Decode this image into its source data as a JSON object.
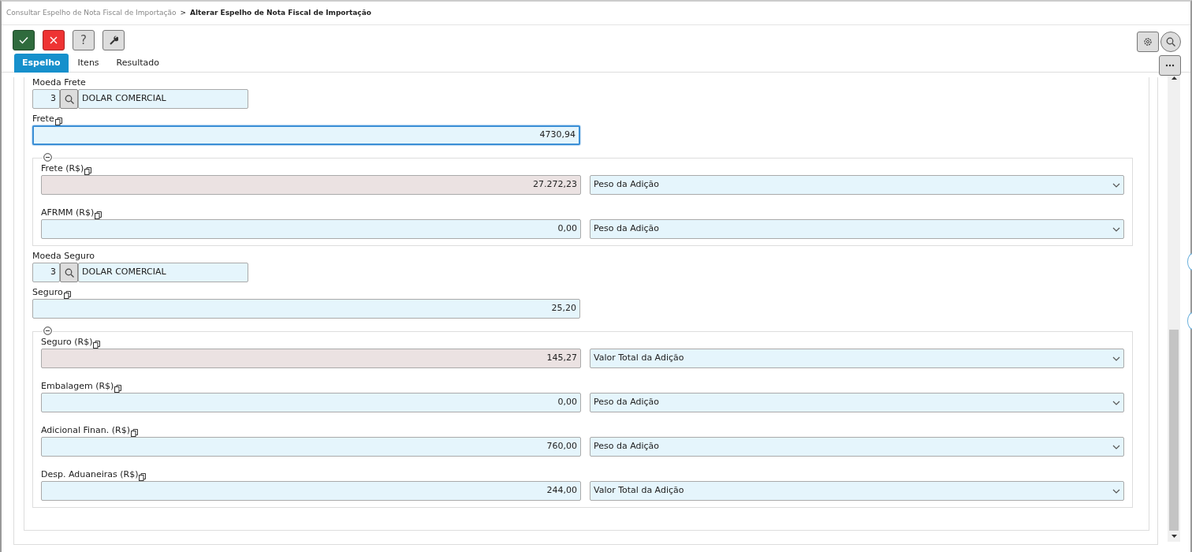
{
  "breadcrumb": [
    {
      "text": "Consultar Espelho de Nota Fiscal de Importação",
      "current": false
    },
    {
      "text": "Alterar Espelho de Nota Fiscal de Importação",
      "current": true
    }
  ],
  "breadcrumb_separator": ">",
  "toolbar": [
    {
      "kind": "confirm"
    },
    {
      "kind": "cancel"
    },
    {
      "kind": "help",
      "text": "?"
    },
    {
      "kind": "tools"
    }
  ],
  "toolbar_right": [
    {
      "kind": "settings"
    },
    {
      "kind": "search"
    }
  ],
  "tabs": [
    {
      "label": "Espelho",
      "selected": true
    },
    {
      "label": "Itens",
      "selected": false
    },
    {
      "label": "Resultado",
      "selected": false
    }
  ],
  "sections": [
    {
      "kind": "currency",
      "label": "Moeda Frete",
      "code": "3",
      "name": "DOLAR COMERCIAL"
    },
    {
      "kind": "amount",
      "label": "Frete",
      "value": "4730,94",
      "focused": true
    },
    {
      "kind": "group",
      "expanded": true,
      "rows": [
        {
          "label": "Frete (R$)",
          "value": "27.272,23",
          "readonly": true,
          "rateio": "Peso da Adição"
        },
        {
          "label": "AFRMM (R$)",
          "value": "0,00",
          "readonly": false,
          "rateio": "Peso da Adição"
        }
      ]
    },
    {
      "kind": "currency",
      "label": "Moeda Seguro",
      "code": "3",
      "name": "DOLAR COMERCIAL"
    },
    {
      "kind": "amount",
      "label": "Seguro",
      "value": "25,20",
      "focused": false
    },
    {
      "kind": "group",
      "expanded": true,
      "rows": [
        {
          "label": "Seguro (R$)",
          "value": "145,27",
          "readonly": true,
          "rateio": "Valor Total da Adição"
        },
        {
          "label": "Embalagem (R$)",
          "value": "0,00",
          "readonly": false,
          "rateio": "Peso da Adição"
        },
        {
          "label": "Adicional Finan. (R$)",
          "value": "760,00",
          "readonly": false,
          "rateio": "Peso da Adição"
        },
        {
          "label": "Desp. Aduaneiras (R$)",
          "value": "244,00",
          "readonly": false,
          "rateio": "Valor Total da Adição"
        }
      ]
    }
  ]
}
